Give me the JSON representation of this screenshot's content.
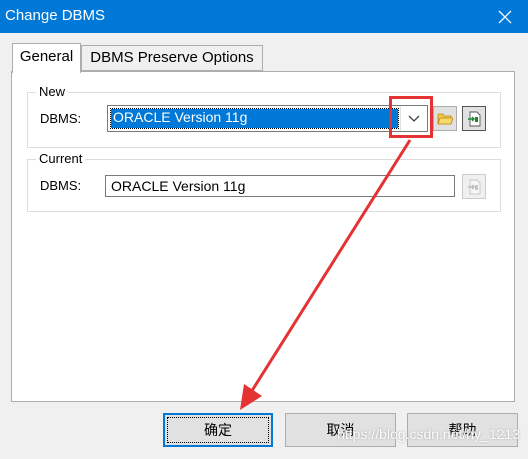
{
  "window": {
    "title": "Change DBMS",
    "close_icon": "close-icon"
  },
  "tabs": [
    {
      "label": "General",
      "active": true
    },
    {
      "label": "DBMS Preserve Options",
      "active": false
    }
  ],
  "new_group": {
    "legend": "New",
    "dbms_label": "DBMS:",
    "dbms_value": "ORACLE Version 11g",
    "dropdown_icon": "chevron-down-icon",
    "folder_icon": "folder-icon",
    "extract_icon": "document-extract-icon"
  },
  "current_group": {
    "legend": "Current",
    "dbms_label": "DBMS:",
    "dbms_value": "ORACLE Version 11g",
    "extract_icon": "document-extract-icon"
  },
  "buttons": {
    "ok": "确定",
    "cancel": "取消",
    "help": "帮助"
  },
  "annotations": {
    "highlight_color": "#e53333",
    "arrow_color": "#e53333"
  },
  "watermark": "https://blog.csdn.net/hy_1213",
  "colors": {
    "titlebar": "#0078d7",
    "selection": "#0078d7",
    "default_button_border": "#0078d7"
  }
}
